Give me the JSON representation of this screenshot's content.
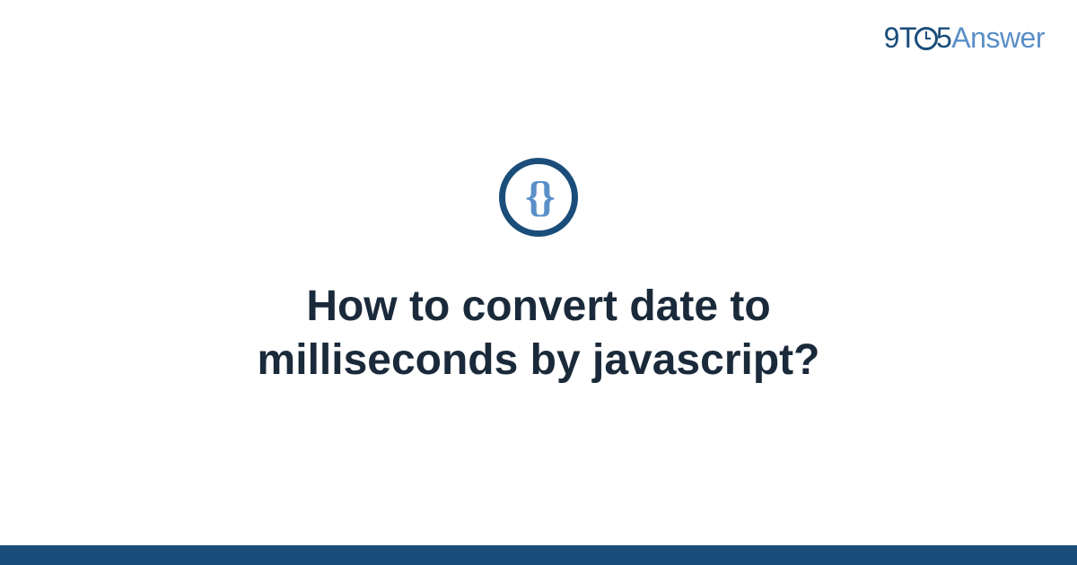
{
  "logo": {
    "part1": "9T",
    "part2": "5",
    "part3": "Answer"
  },
  "icon": {
    "glyph": "{}"
  },
  "title": "How to convert date to milliseconds by javascript?"
}
